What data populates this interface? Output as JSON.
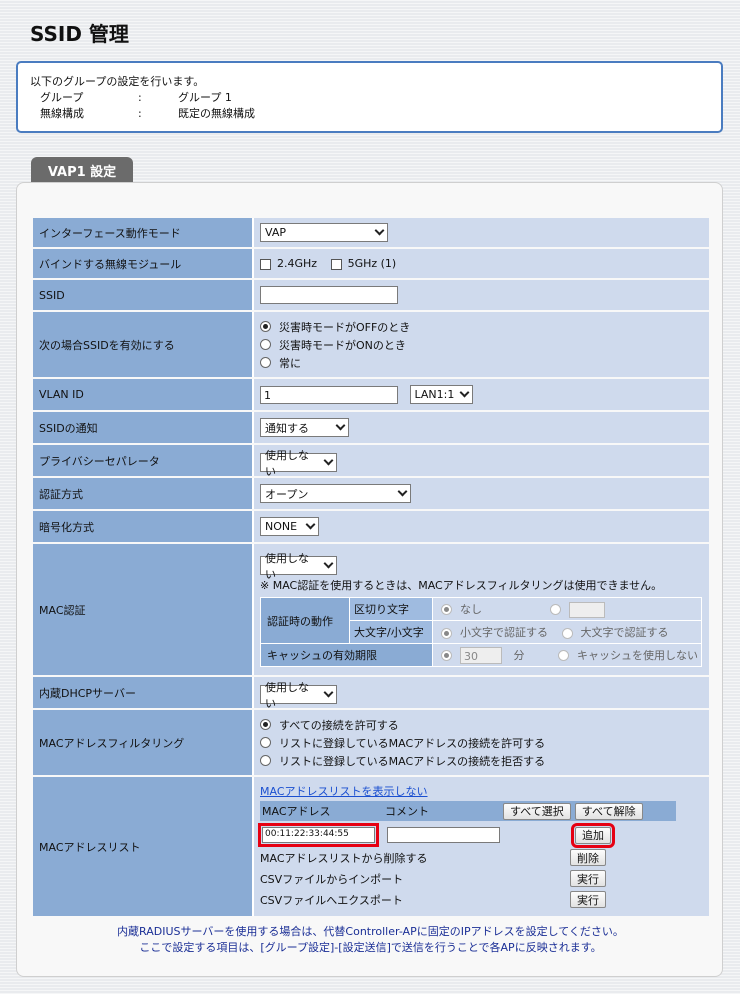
{
  "page": {
    "title": "SSID 管理"
  },
  "info": {
    "intro": "以下のグループの設定を行います。",
    "rows": [
      {
        "key": "グループ",
        "colon": ":",
        "value": "グループ 1"
      },
      {
        "key": "無線構成",
        "colon": ":",
        "value": "既定の無線構成"
      }
    ]
  },
  "tab": {
    "label": "VAP1 設定"
  },
  "fields": {
    "iface_mode": {
      "label": "インターフェース動作モード",
      "value": "VAP"
    },
    "bind": {
      "label": "バインドする無線モジュール",
      "opt1": "2.4GHz",
      "opt2": "5GHz (1)"
    },
    "ssid": {
      "label": "SSID",
      "value": ""
    },
    "enable_when": {
      "label": "次の場合SSIDを有効にする",
      "options": [
        "災害時モードがOFFのとき",
        "災害時モードがONのとき",
        "常に"
      ]
    },
    "vlan": {
      "label": "VLAN ID",
      "value": "1",
      "lan": "LAN1:1"
    },
    "ssid_notify": {
      "label": "SSIDの通知",
      "value": "通知する"
    },
    "privacy": {
      "label": "プライバシーセパレータ",
      "value": "使用しない"
    },
    "auth": {
      "label": "認証方式",
      "value": "オープン"
    },
    "encryption": {
      "label": "暗号化方式",
      "value": "NONE"
    },
    "mac_auth": {
      "label": "MAC認証",
      "value": "使用しない",
      "note": "※ MAC認証を使用するときは、MACアドレスフィルタリングは使用できません。",
      "action_label": "認証時の動作",
      "delimiter_label": "区切り文字",
      "delimiter_none": "なし",
      "case_label": "大文字/小文字",
      "case_lower": "小文字で認証する",
      "case_upper": "大文字で認証する",
      "cache_label": "キャッシュの有効期限",
      "cache_value": "30",
      "cache_unit": "分",
      "cache_off": "キャッシュを使用しない"
    },
    "dhcp": {
      "label": "内蔵DHCPサーバー",
      "value": "使用しない"
    },
    "mac_filter": {
      "label": "MACアドレスフィルタリング",
      "options": [
        "すべての接続を許可する",
        "リストに登録しているMACアドレスの接続を許可する",
        "リストに登録しているMACアドレスの接続を拒否する"
      ]
    },
    "mac_list": {
      "label": "MACアドレスリスト",
      "toggle_link": "MACアドレスリストを表示しない",
      "col_mac": "MACアドレス",
      "col_comment": "コメント",
      "select_all": "すべて選択",
      "deselect_all": "すべて解除",
      "mac_value": "00:11:22:33:44:55",
      "comment_value": "",
      "add": "追加",
      "delete_label": "MACアドレスリストから削除する",
      "delete_btn": "削除",
      "import_label": "CSVファイルからインポート",
      "import_btn": "実行",
      "export_label": "CSVファイルへエクスポート",
      "export_btn": "実行"
    }
  },
  "footer": {
    "line1": "内蔵RADIUSサーバーを使用する場合は、代替Controller-APに固定のIPアドレスを設定してください。",
    "line2": "ここで設定する項目は、[グループ設定]-[設定送信]で送信を行うことで各APに反映されます。"
  }
}
